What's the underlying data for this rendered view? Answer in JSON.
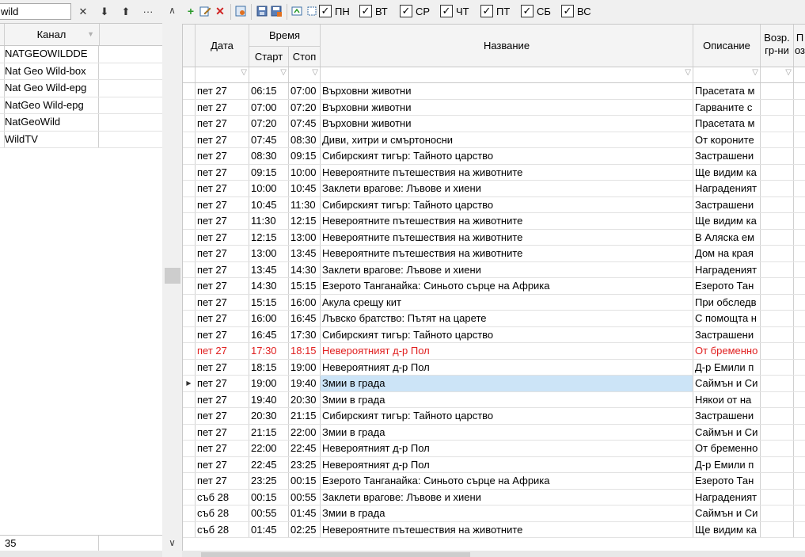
{
  "left_panel": {
    "search_value": "wild",
    "toolbar": {
      "clear": "✕",
      "down": "⬇",
      "up": "⬆",
      "more": "···"
    },
    "column_header": "Канал",
    "channels": [
      "NATGEOWILDDE",
      "Nat Geo Wild-box",
      "Nat Geo Wild-epg",
      "NatGeo Wild-epg",
      "NatGeoWild",
      "WildTV"
    ],
    "footer_count": "35"
  },
  "scrollbar": {
    "up": "∧",
    "down": "∨"
  },
  "toolbar": {
    "days": [
      {
        "label": "ПН",
        "checked": true
      },
      {
        "label": "ВТ",
        "checked": true
      },
      {
        "label": "СР",
        "checked": true
      },
      {
        "label": "ЧТ",
        "checked": true
      },
      {
        "label": "ПТ",
        "checked": true
      },
      {
        "label": "СБ",
        "checked": true
      },
      {
        "label": "ВС",
        "checked": true
      }
    ],
    "check_mark": "✓"
  },
  "grid": {
    "headers": {
      "date": "Дата",
      "time": "Время",
      "start": "Старт",
      "stop": "Стоп",
      "title": "Название",
      "description": "Описание",
      "age": "Возр.",
      "age2": "гр-ни",
      "extra": "П",
      "extra2": "оз"
    },
    "rows": [
      [
        "пет 27",
        "06:15",
        "07:00",
        "Върховни животни",
        "Прасетата м"
      ],
      [
        "пет 27",
        "07:00",
        "07:20",
        "Върховни животни",
        "Гарваните с"
      ],
      [
        "пет 27",
        "07:20",
        "07:45",
        "Върховни животни",
        "Прасетата м"
      ],
      [
        "пет 27",
        "07:45",
        "08:30",
        "Диви, хитри и смъртоносни",
        "От короните"
      ],
      [
        "пет 27",
        "08:30",
        "09:15",
        "Сибирският тигър: Тайното царство",
        "Застрашени"
      ],
      [
        "пет 27",
        "09:15",
        "10:00",
        "Невероятните пътешествия на животните",
        "Ще видим ка"
      ],
      [
        "пет 27",
        "10:00",
        "10:45",
        "Заклети врагове: Лъвове и хиени",
        "Награденият"
      ],
      [
        "пет 27",
        "10:45",
        "11:30",
        "Сибирският тигър: Тайното царство",
        "Застрашени"
      ],
      [
        "пет 27",
        "11:30",
        "12:15",
        "Невероятните пътешествия на животните",
        "Ще видим ка"
      ],
      [
        "пет 27",
        "12:15",
        "13:00",
        "Невероятните пътешествия на животните",
        "В Аляска ем"
      ],
      [
        "пет 27",
        "13:00",
        "13:45",
        "Невероятните пътешествия на животните",
        "Дом на края"
      ],
      [
        "пет 27",
        "13:45",
        "14:30",
        "Заклети врагове: Лъвове и хиени",
        "Награденият"
      ],
      [
        "пет 27",
        "14:30",
        "15:15",
        "Езерото Танганайка: Синьото сърце на Африка",
        "Езерото Тан"
      ],
      [
        "пет 27",
        "15:15",
        "16:00",
        "Акула срещу кит",
        "При обследв"
      ],
      [
        "пет 27",
        "16:00",
        "16:45",
        "Лъвско братство: Пътят на царете",
        "С помощта н"
      ],
      [
        "пет 27",
        "16:45",
        "17:30",
        "Сибирският тигър: Тайното царство",
        "Застрашени"
      ],
      [
        "пет 27",
        "17:30",
        "18:15",
        "Невероятният д-р Пол",
        "От бременно"
      ],
      [
        "пет 27",
        "18:15",
        "19:00",
        "Невероятният д-р Пол",
        "Д-р Емили п"
      ],
      [
        "пет 27",
        "19:00",
        "19:40",
        "Змии в града",
        "Саймън и Си"
      ],
      [
        "пет 27",
        "19:40",
        "20:30",
        "Змии в града",
        "Някои от на"
      ],
      [
        "пет 27",
        "20:30",
        "21:15",
        "Сибирският тигър: Тайното царство",
        "Застрашени"
      ],
      [
        "пет 27",
        "21:15",
        "22:00",
        "Змии в града",
        "Саймън и Си"
      ],
      [
        "пет 27",
        "22:00",
        "22:45",
        "Невероятният д-р Пол",
        "От бременно"
      ],
      [
        "пет 27",
        "22:45",
        "23:25",
        "Невероятният д-р Пол",
        "Д-р Емили п"
      ],
      [
        "пет 27",
        "23:25",
        "00:15",
        "Езерото Танганайка: Синьото сърце на Африка",
        "Езерото Тан"
      ],
      [
        "съб 28",
        "00:15",
        "00:55",
        "Заклети врагове: Лъвове и хиени",
        "Награденият"
      ],
      [
        "съб 28",
        "00:55",
        "01:45",
        "Змии в града",
        "Саймън и Си"
      ],
      [
        "съб 28",
        "01:45",
        "02:25",
        "Невероятните пътешествия на животните",
        "Ще видим ка"
      ]
    ],
    "highlight_row": 16,
    "selected_row": 18,
    "row_pointer": "▶",
    "highlight_color": "#e02020",
    "selection_color": "#cce4f7"
  }
}
